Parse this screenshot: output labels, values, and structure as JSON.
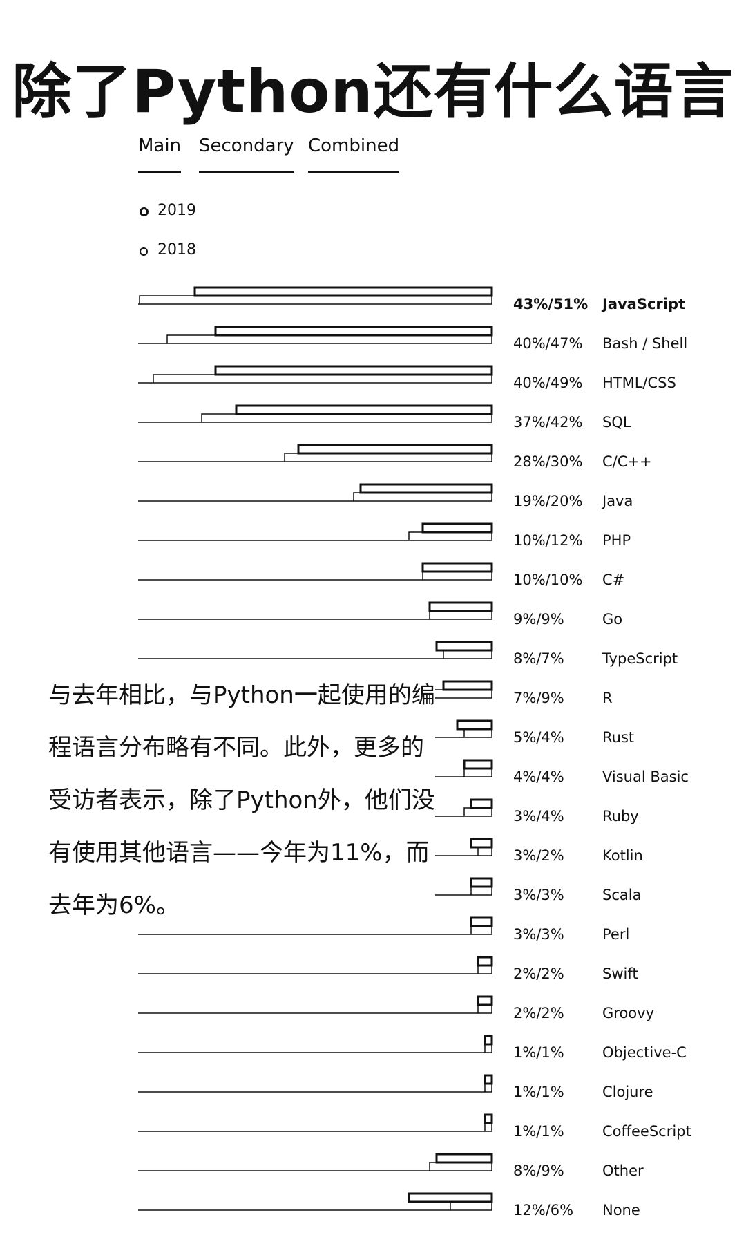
{
  "title": "除了Python还有什么语言",
  "tabs": [
    {
      "label": "Main",
      "active": true
    },
    {
      "label": "Secondary",
      "active": false
    },
    {
      "label": "Combined",
      "active": false
    }
  ],
  "annotation": "与去年相比，与Python一起使用的编程语言分布略有不同。此外，更多的受访者表示，除了Python外，他们没有使用其他语言——今年为11%，而去年为6%。",
  "colors": {
    "ink": "#111111",
    "background": "#ffffff"
  },
  "chart_data": {
    "type": "bar",
    "orientation": "horizontal",
    "series": [
      {
        "name": "2019",
        "values": [
          43,
          40,
          40,
          37,
          28,
          19,
          10,
          10,
          9,
          8,
          7,
          5,
          4,
          3,
          3,
          3,
          3,
          2,
          2,
          1,
          1,
          1,
          8,
          12
        ]
      },
      {
        "name": "2018",
        "values": [
          51,
          47,
          49,
          42,
          30,
          20,
          12,
          10,
          9,
          7,
          9,
          4,
          4,
          4,
          2,
          3,
          3,
          2,
          2,
          1,
          1,
          1,
          9,
          6
        ]
      }
    ],
    "categories": [
      "JavaScript",
      "Bash / Shell",
      "HTML/CSS",
      "SQL",
      "C/C++",
      "Java",
      "PHP",
      "C#",
      "Go",
      "TypeScript",
      "R",
      "Rust",
      "Visual Basic",
      "Ruby",
      "Kotlin",
      "Scala",
      "Perl",
      "Swift",
      "Groovy",
      "Objective-C",
      "Clojure",
      "CoffeeScript",
      "Other",
      "None"
    ],
    "value_labels": [
      "43%/51%",
      "40%/47%",
      "40%/49%",
      "37%/42%",
      "28%/30%",
      "19%/20%",
      "10%/12%",
      "10%/10%",
      "9%/9%",
      "8%/7%",
      "7%/9%",
      "5%/4%",
      "4%/4%",
      "3%/4%",
      "3%/2%",
      "3%/3%",
      "3%/3%",
      "2%/2%",
      "2%/2%",
      "1%/1%",
      "1%/1%",
      "1%/1%",
      "8%/9%",
      "12%/6%"
    ],
    "highlighted_category": "JavaScript",
    "bar_direction": "right-to-left",
    "xlim": [
      0,
      100
    ],
    "grid": false,
    "legend_position": "top-left"
  }
}
